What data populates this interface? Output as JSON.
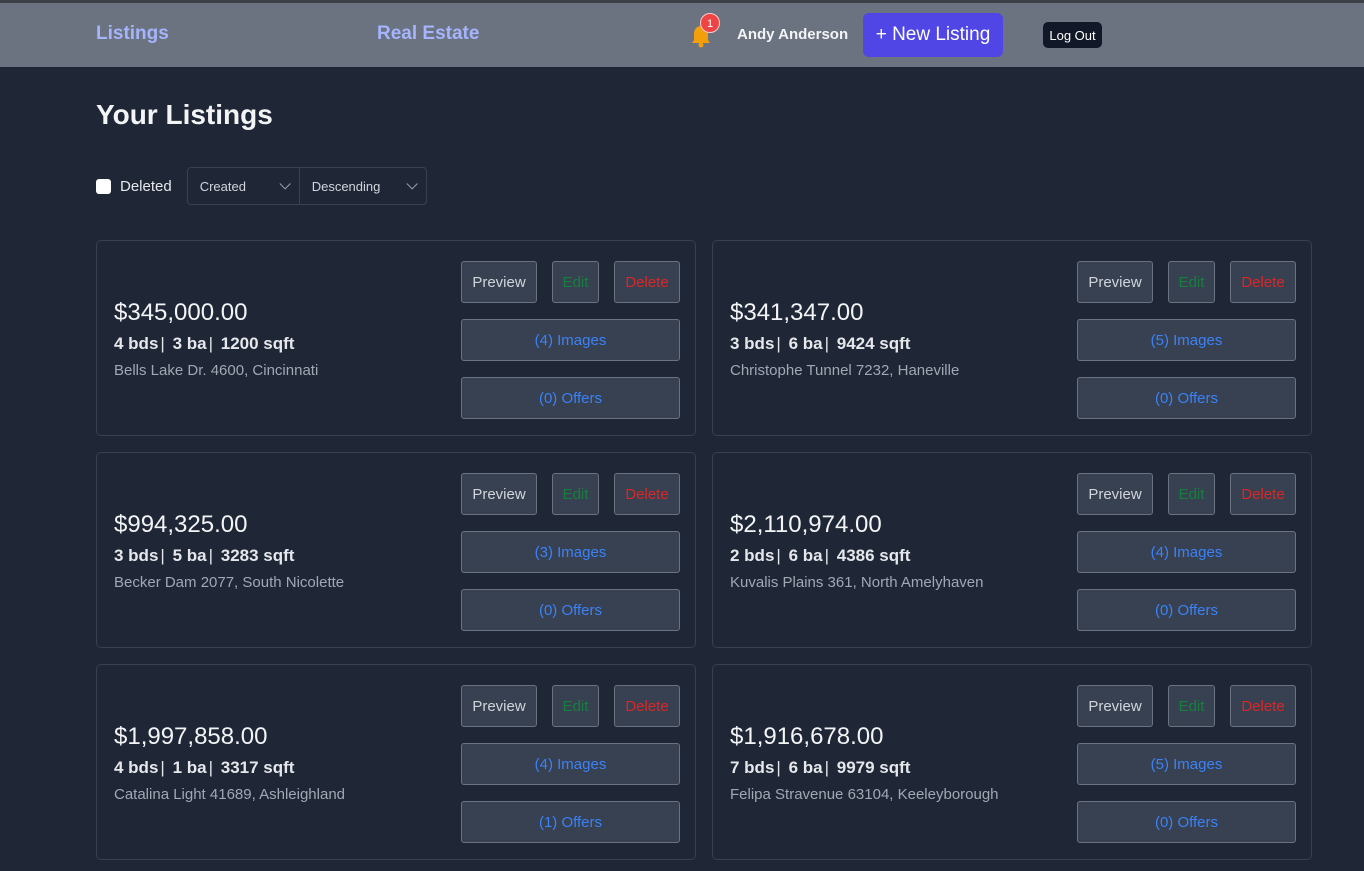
{
  "header": {
    "nav_listings": "Listings",
    "nav_real_estate": "Real Estate",
    "notification_count": "1",
    "user_name": "Andy Anderson",
    "new_listing_label": "+ New Listing",
    "logout_label": "Log Out"
  },
  "page": {
    "title": "Your Listings"
  },
  "filters": {
    "deleted_label": "Deleted",
    "deleted_checked": false,
    "sort_field": "Created",
    "sort_order": "Descending"
  },
  "buttons": {
    "preview": "Preview",
    "edit": "Edit",
    "delete": "Delete"
  },
  "colors": {
    "accent": "#4f46e5",
    "edit": "#15803d",
    "delete": "#dc2626",
    "link": "#3b82f6"
  },
  "listings": [
    {
      "price": "$345,000.00",
      "beds": "4 bds",
      "baths": "3 ba",
      "sqft": "1200 sqft",
      "address": "Bells Lake Dr. 4600, Cincinnati",
      "images": "(4) Images",
      "offers": "(0) Offers"
    },
    {
      "price": "$341,347.00",
      "beds": "3 bds",
      "baths": "6 ba",
      "sqft": "9424 sqft",
      "address": "Christophe Tunnel 7232, Haneville",
      "images": "(5) Images",
      "offers": "(0) Offers"
    },
    {
      "price": "$994,325.00",
      "beds": "3 bds",
      "baths": "5 ba",
      "sqft": "3283 sqft",
      "address": "Becker Dam 2077, South Nicolette",
      "images": "(3) Images",
      "offers": "(0) Offers"
    },
    {
      "price": "$2,110,974.00",
      "beds": "2 bds",
      "baths": "6 ba",
      "sqft": "4386 sqft",
      "address": "Kuvalis Plains 361, North Amelyhaven",
      "images": "(4) Images",
      "offers": "(0) Offers"
    },
    {
      "price": "$1,997,858.00",
      "beds": "4 bds",
      "baths": "1 ba",
      "sqft": "3317 sqft",
      "address": "Catalina Light 41689, Ashleighland",
      "images": "(4) Images",
      "offers": "(1) Offers"
    },
    {
      "price": "$1,916,678.00",
      "beds": "7 bds",
      "baths": "6 ba",
      "sqft": "9979 sqft",
      "address": "Felipa Stravenue 63104, Keeleyborough",
      "images": "(5) Images",
      "offers": "(0) Offers"
    }
  ]
}
